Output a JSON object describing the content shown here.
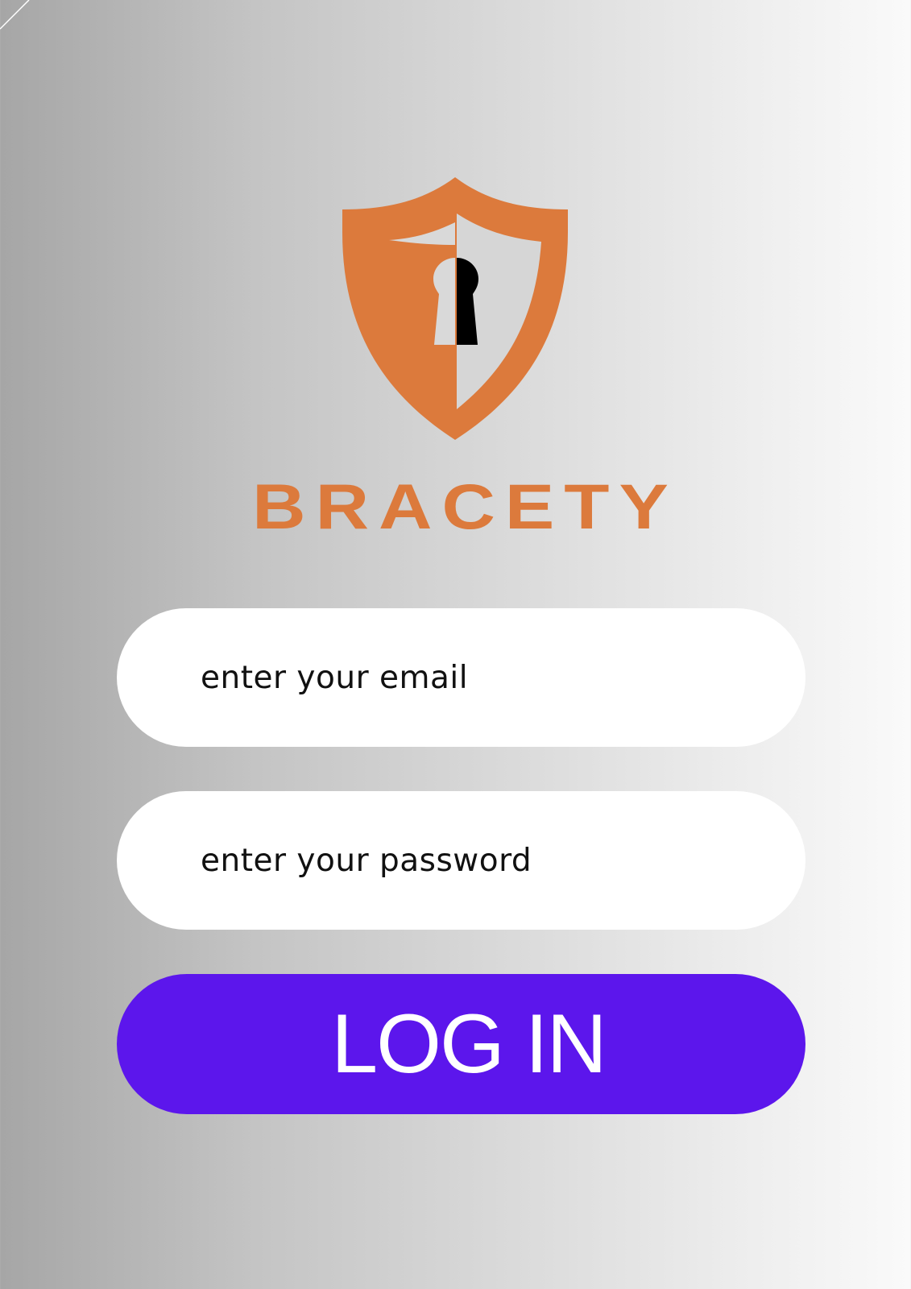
{
  "brand": {
    "name": "BRACETY"
  },
  "logo": {
    "icon": "shield-keyhole-icon"
  },
  "form": {
    "email_placeholder": "enter your email",
    "password_placeholder": "enter your password",
    "login_label": "LOG IN"
  },
  "colors": {
    "brand_orange": "#dc7a3c",
    "button_purple": "#5c16ec",
    "field_background": "#ffffff",
    "keyhole_dark": "#000000"
  }
}
